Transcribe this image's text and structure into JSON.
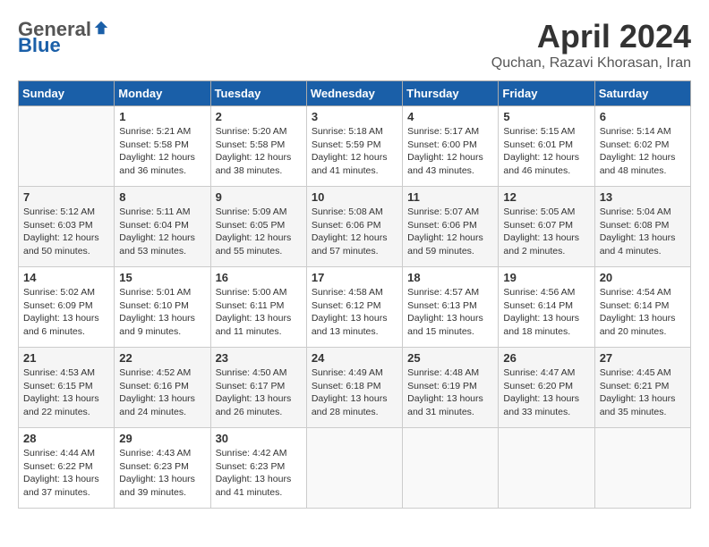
{
  "header": {
    "logo_general": "General",
    "logo_blue": "Blue",
    "month_year": "April 2024",
    "location": "Quchan, Razavi Khorasan, Iran"
  },
  "days_of_week": [
    "Sunday",
    "Monday",
    "Tuesday",
    "Wednesday",
    "Thursday",
    "Friday",
    "Saturday"
  ],
  "weeks": [
    [
      {
        "day": "",
        "info": ""
      },
      {
        "day": "1",
        "info": "Sunrise: 5:21 AM\nSunset: 5:58 PM\nDaylight: 12 hours\nand 36 minutes."
      },
      {
        "day": "2",
        "info": "Sunrise: 5:20 AM\nSunset: 5:58 PM\nDaylight: 12 hours\nand 38 minutes."
      },
      {
        "day": "3",
        "info": "Sunrise: 5:18 AM\nSunset: 5:59 PM\nDaylight: 12 hours\nand 41 minutes."
      },
      {
        "day": "4",
        "info": "Sunrise: 5:17 AM\nSunset: 6:00 PM\nDaylight: 12 hours\nand 43 minutes."
      },
      {
        "day": "5",
        "info": "Sunrise: 5:15 AM\nSunset: 6:01 PM\nDaylight: 12 hours\nand 46 minutes."
      },
      {
        "day": "6",
        "info": "Sunrise: 5:14 AM\nSunset: 6:02 PM\nDaylight: 12 hours\nand 48 minutes."
      }
    ],
    [
      {
        "day": "7",
        "info": "Sunrise: 5:12 AM\nSunset: 6:03 PM\nDaylight: 12 hours\nand 50 minutes."
      },
      {
        "day": "8",
        "info": "Sunrise: 5:11 AM\nSunset: 6:04 PM\nDaylight: 12 hours\nand 53 minutes."
      },
      {
        "day": "9",
        "info": "Sunrise: 5:09 AM\nSunset: 6:05 PM\nDaylight: 12 hours\nand 55 minutes."
      },
      {
        "day": "10",
        "info": "Sunrise: 5:08 AM\nSunset: 6:06 PM\nDaylight: 12 hours\nand 57 minutes."
      },
      {
        "day": "11",
        "info": "Sunrise: 5:07 AM\nSunset: 6:06 PM\nDaylight: 12 hours\nand 59 minutes."
      },
      {
        "day": "12",
        "info": "Sunrise: 5:05 AM\nSunset: 6:07 PM\nDaylight: 13 hours\nand 2 minutes."
      },
      {
        "day": "13",
        "info": "Sunrise: 5:04 AM\nSunset: 6:08 PM\nDaylight: 13 hours\nand 4 minutes."
      }
    ],
    [
      {
        "day": "14",
        "info": "Sunrise: 5:02 AM\nSunset: 6:09 PM\nDaylight: 13 hours\nand 6 minutes."
      },
      {
        "day": "15",
        "info": "Sunrise: 5:01 AM\nSunset: 6:10 PM\nDaylight: 13 hours\nand 9 minutes."
      },
      {
        "day": "16",
        "info": "Sunrise: 5:00 AM\nSunset: 6:11 PM\nDaylight: 13 hours\nand 11 minutes."
      },
      {
        "day": "17",
        "info": "Sunrise: 4:58 AM\nSunset: 6:12 PM\nDaylight: 13 hours\nand 13 minutes."
      },
      {
        "day": "18",
        "info": "Sunrise: 4:57 AM\nSunset: 6:13 PM\nDaylight: 13 hours\nand 15 minutes."
      },
      {
        "day": "19",
        "info": "Sunrise: 4:56 AM\nSunset: 6:14 PM\nDaylight: 13 hours\nand 18 minutes."
      },
      {
        "day": "20",
        "info": "Sunrise: 4:54 AM\nSunset: 6:14 PM\nDaylight: 13 hours\nand 20 minutes."
      }
    ],
    [
      {
        "day": "21",
        "info": "Sunrise: 4:53 AM\nSunset: 6:15 PM\nDaylight: 13 hours\nand 22 minutes."
      },
      {
        "day": "22",
        "info": "Sunrise: 4:52 AM\nSunset: 6:16 PM\nDaylight: 13 hours\nand 24 minutes."
      },
      {
        "day": "23",
        "info": "Sunrise: 4:50 AM\nSunset: 6:17 PM\nDaylight: 13 hours\nand 26 minutes."
      },
      {
        "day": "24",
        "info": "Sunrise: 4:49 AM\nSunset: 6:18 PM\nDaylight: 13 hours\nand 28 minutes."
      },
      {
        "day": "25",
        "info": "Sunrise: 4:48 AM\nSunset: 6:19 PM\nDaylight: 13 hours\nand 31 minutes."
      },
      {
        "day": "26",
        "info": "Sunrise: 4:47 AM\nSunset: 6:20 PM\nDaylight: 13 hours\nand 33 minutes."
      },
      {
        "day": "27",
        "info": "Sunrise: 4:45 AM\nSunset: 6:21 PM\nDaylight: 13 hours\nand 35 minutes."
      }
    ],
    [
      {
        "day": "28",
        "info": "Sunrise: 4:44 AM\nSunset: 6:22 PM\nDaylight: 13 hours\nand 37 minutes."
      },
      {
        "day": "29",
        "info": "Sunrise: 4:43 AM\nSunset: 6:23 PM\nDaylight: 13 hours\nand 39 minutes."
      },
      {
        "day": "30",
        "info": "Sunrise: 4:42 AM\nSunset: 6:23 PM\nDaylight: 13 hours\nand 41 minutes."
      },
      {
        "day": "",
        "info": ""
      },
      {
        "day": "",
        "info": ""
      },
      {
        "day": "",
        "info": ""
      },
      {
        "day": "",
        "info": ""
      }
    ]
  ]
}
